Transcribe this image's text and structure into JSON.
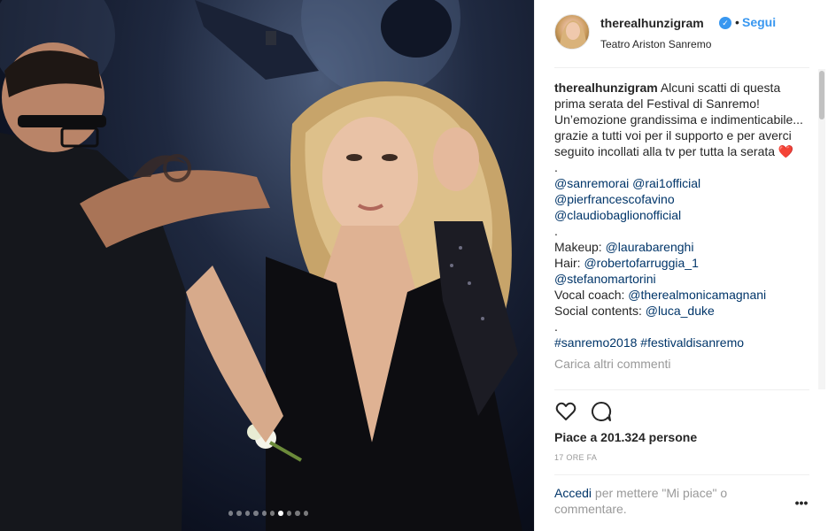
{
  "post": {
    "username": "therealhunzigram",
    "verified_icon": "verified-badge-icon",
    "separator": "•",
    "follow_label": "Segui",
    "location": "Teatro Ariston Sanremo",
    "carousel": {
      "total_dots": 10,
      "active_index": 6
    },
    "caption": {
      "text": "Alcuni scatti di questa prima serata del Festival di Sanremo! Un’emozione grandissima e indimenticabile... grazie a tutti voi per il supporto e per averci seguito incollati alla tv per tutta la serata",
      "emoji": "❤️",
      "dot_1": ".",
      "mentions_1": "@sanremorai @rai1official",
      "mention_2": "@pierfrancescofavino",
      "mention_3": "@claudiobaglionofficial",
      "dot_2": ".",
      "makeup_label": "Makeup:",
      "makeup_user": "@laurabarenghi",
      "hair_label": "Hair:",
      "hair_user_1": "@robertofarruggia_1",
      "hair_user_2": "@stefanomartorini",
      "vocal_label": "Vocal coach:",
      "vocal_user": "@therealmonicamagnani",
      "social_label": "Social contents:",
      "social_user": "@luca_duke",
      "dot_3": ".",
      "hashtags": "#sanremo2018 #festivaldisanremo"
    },
    "load_more": "Carica altri commenti",
    "likes_text": "Piace a 201.324 persone",
    "timestamp": "17 ORE FA",
    "login_link": "Accedi",
    "login_rest": " per mettere \"Mi piace\" o commentare.",
    "more_label": "•••",
    "icons": {
      "like": "heart-outline-icon",
      "comment": "comment-bubble-icon",
      "more": "more-options-icon"
    }
  },
  "colors": {
    "link_blue": "#3897f0",
    "mention_navy": "#003569",
    "muted_gray": "#999999",
    "text_dark": "#262626"
  }
}
